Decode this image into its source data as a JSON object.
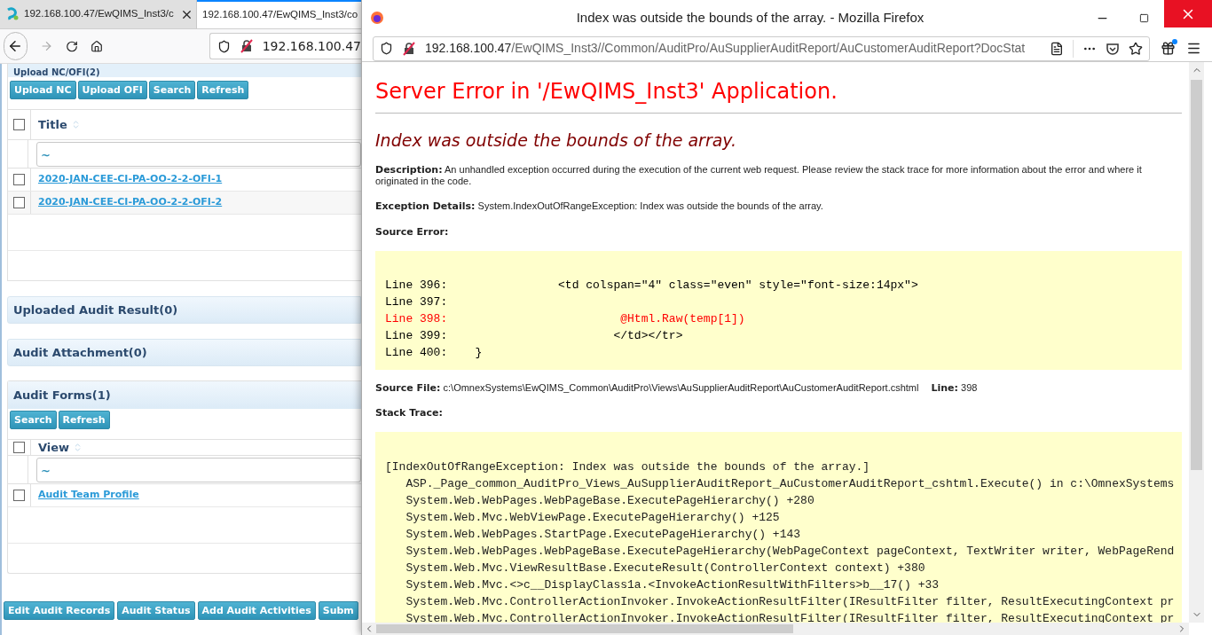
{
  "background_browser": {
    "tabs": [
      {
        "title": "192.168.100.47/EwQIMS_Inst3/c",
        "selected": false,
        "closable": true
      },
      {
        "title": "192.168.100.47/EwQIMS_Inst3/co",
        "selected": true
      }
    ],
    "address": "192.168.100.47"
  },
  "page": {
    "nc_section": {
      "title": "Upload NC/OFI(2)",
      "buttons": [
        "Upload NC",
        "Upload OFI",
        "Search",
        "Refresh"
      ],
      "column": "Title",
      "select_all_checked": false,
      "filter": "~",
      "rows": [
        {
          "link": "2020-JAN-CEE-CI-PA-OO-2-2-OFI-1",
          "checked": false
        },
        {
          "link": "2020-JAN-CEE-CI-PA-OO-2-2-OFI-2",
          "checked": false
        }
      ]
    },
    "collapsed_sections": [
      "Uploaded Audit Result(0)",
      "Audit Attachment(0)"
    ],
    "forms_section": {
      "title": "Audit Forms(1)",
      "buttons": [
        "Search",
        "Refresh"
      ],
      "column": "View",
      "select_all_checked": false,
      "filter": "~",
      "rows": [
        {
          "link": "Audit Team Profile",
          "checked": false
        }
      ]
    },
    "footer_buttons": [
      "Edit Audit Records",
      "Audit Status",
      "Add Audit Activities",
      "Subm"
    ]
  },
  "popup": {
    "title": "Index was outside the bounds of the array. - Mozilla Firefox",
    "url_host": "192.168.100.47",
    "url_path": "/EwQIMS_Inst3//Common/AuditPro/AuSupplierAuditReport/AuCustomerAuditReport?DocStat",
    "heading": "Server Error in '/EwQIMS_Inst3' Application.",
    "subheading": "Index was outside the bounds of the array.",
    "description_label": "Description:",
    "description": "An unhandled exception occurred during the execution of the current web request. Please review the stack trace for more information about the error and where it originated in the code.",
    "exception_label": "Exception Details:",
    "exception": "System.IndexOutOfRangeException: Index was outside the bounds of the array.",
    "source_error_label": "Source Error:",
    "source_lines": [
      {
        "text": "Line 396:                <td colspan=\"4\" class=\"even\" style=\"font-size:14px\">",
        "error": false
      },
      {
        "text": "Line 397:",
        "error": false
      },
      {
        "text": "Line 398:                         @Html.Raw(temp[1])",
        "error": true
      },
      {
        "text": "Line 399:                        </td></tr>",
        "error": false
      },
      {
        "text": "Line 400:    }",
        "error": false
      }
    ],
    "source_file_label": "Source File:",
    "source_file": "c:\\OmnexSystems\\EwQIMS_Common\\AuditPro\\Views\\AuSupplierAuditReport\\AuCustomerAuditReport.cshtml",
    "line_label": "Line:",
    "line": "398",
    "stack_trace_label": "Stack Trace:",
    "stack_lines": [
      "[IndexOutOfRangeException: Index was outside the bounds of the array.]",
      "   ASP._Page_common_AuditPro_Views_AuSupplierAuditReport_AuCustomerAuditReport_cshtml.Execute() in c:\\OmnexSystems",
      "   System.Web.WebPages.WebPageBase.ExecutePageHierarchy() +280",
      "   System.Web.Mvc.WebViewPage.ExecutePageHierarchy() +125",
      "   System.Web.WebPages.StartPage.ExecutePageHierarchy() +143",
      "   System.Web.WebPages.WebPageBase.ExecutePageHierarchy(WebPageContext pageContext, TextWriter writer, WebPageRend",
      "   System.Web.Mvc.ViewResultBase.ExecuteResult(ControllerContext context) +380",
      "   System.Web.Mvc.<>c__DisplayClass1a.<InvokeActionResultWithFilters>b__17() +33",
      "   System.Web.Mvc.ControllerActionInvoker.InvokeActionResultFilter(IResultFilter filter, ResultExecutingContext pr",
      "   System.Web.Mvc.ControllerActionInvoker.InvokeActionResultFilter(IResultFilter filter, ResultExecutingContext pr"
    ]
  }
}
